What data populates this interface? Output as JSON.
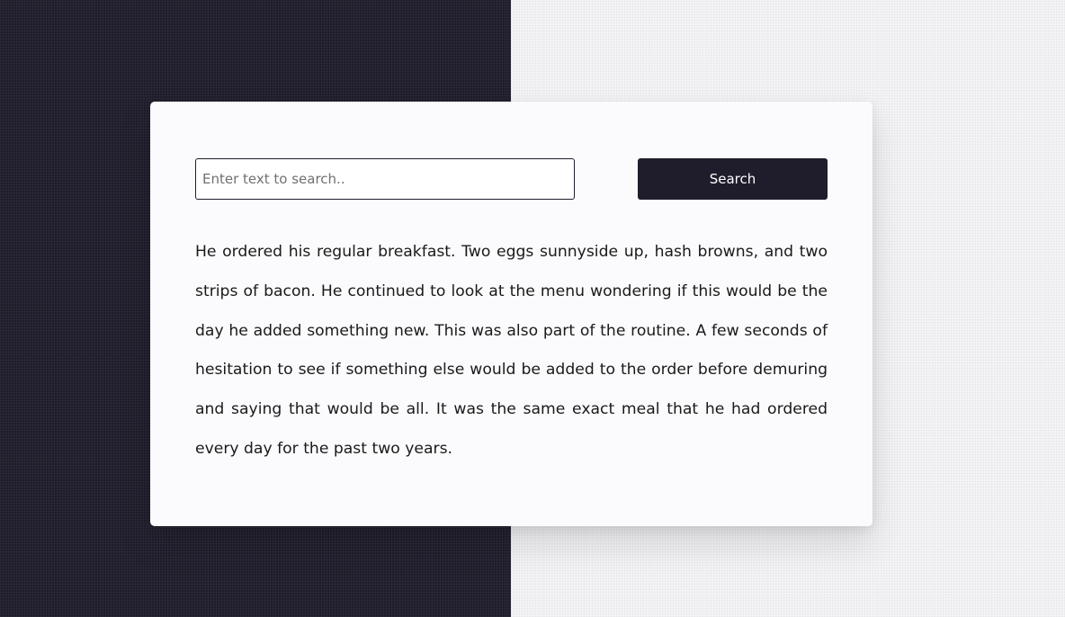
{
  "theme": {
    "dark_color": "#1f1d2b",
    "light_color": "#f4f4f6",
    "card_color": "#fbfbfd"
  },
  "search": {
    "placeholder": "Enter text to search..",
    "value": "",
    "button_label": "Search"
  },
  "content": {
    "paragraph": "He ordered his regular breakfast. Two eggs sunnyside up, hash browns, and two strips of bacon. He continued to look at the menu wondering if this would be the day he added something new. This was also part of the routine. A few seconds of hesitation to see if something else would be added to the order before demuring and saying that would be all. It was the same exact meal that he had ordered every day for the past two years."
  }
}
